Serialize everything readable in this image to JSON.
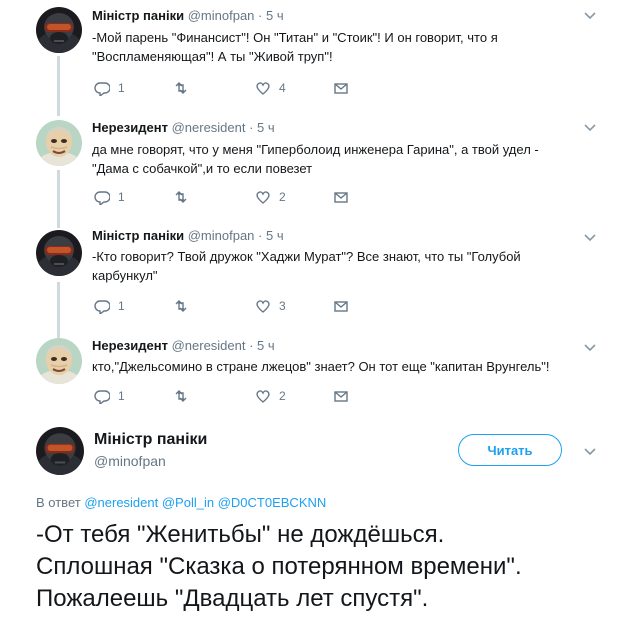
{
  "tweets": [
    {
      "name": "Міністр паніки",
      "handle": "@minofpan",
      "time": "· 5 ч",
      "lines": [
        "-Мой парень \"Финансист\"! Он \"Титан\" и \"Стоик\"! И он говорит, что я",
        "\"Воспламеняющая\"! А ты \"Живой труп\"!"
      ],
      "replies": "1",
      "likes": "4"
    },
    {
      "name": "Нерезидент",
      "handle": "@neresident",
      "time": "· 5 ч",
      "lines": [
        "да мне говорят, что у меня \"Гиперболоид инженера Гарина\", а твой удел -",
        "\"Дама с собачкой\",и то если повезет"
      ],
      "replies": "1",
      "likes": "2"
    },
    {
      "name": "Міністр паніки",
      "handle": "@minofpan",
      "time": "· 5 ч",
      "lines": [
        "-Кто говорит? Твой дружок \"Хаджи Мурат\"? Все знают, что ты \"Голубой",
        "карбункул\""
      ],
      "replies": "1",
      "likes": "3"
    },
    {
      "name": "Нерезидент",
      "handle": "@neresident",
      "time": "· 5 ч",
      "lines": [
        "кто,\"Джельсомино в стране лжецов\" знает? Он тот еще \"капитан Врунгель\"!"
      ],
      "replies": "1",
      "likes": "2"
    }
  ],
  "main": {
    "name": "Міністр паніки",
    "handle": "@minofpan",
    "follow_label": "Читать",
    "reply_prefix": "В ответ",
    "mentions": [
      "@neresident",
      "@Poll_in",
      "@D0CT0EBCKNN"
    ],
    "text_lines": [
      "-От тебя \"Женитьбы\" не дождёшься.",
      "Сплошная \"Сказка о потерянном времени\".",
      "Пожалеешь \"Двадцать лет спустя\"."
    ]
  },
  "colors": {
    "accent": "#1da1f2",
    "muted": "#657786",
    "text": "#14171a",
    "thread": "#cfd9de"
  },
  "icons": [
    "reply-icon",
    "retweet-icon",
    "like-icon",
    "dm-icon",
    "chevron-down-icon"
  ]
}
